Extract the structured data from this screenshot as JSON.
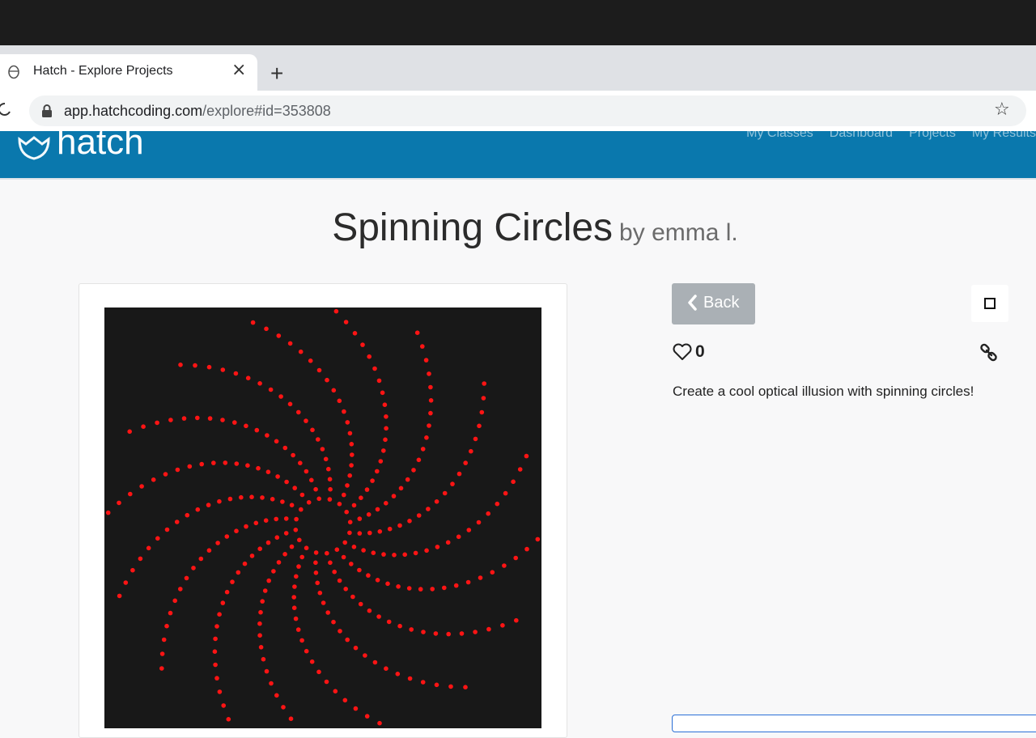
{
  "browser": {
    "tab_title": "Hatch - Explore Projects",
    "close_glyph": "×",
    "new_tab_glyph": "+",
    "url_host": "app.hatchcoding.com",
    "url_path": "/explore#id=353808",
    "bookmark_glyph": "☆"
  },
  "site": {
    "brand": "hatch",
    "brand_color": "#0a78ad",
    "nav": [
      "My Classes",
      "Dashboard",
      "Projects",
      "My Results"
    ]
  },
  "project": {
    "title": "Spinning Circles",
    "byline": "by emma l.",
    "back_label": "Back",
    "likes": "0",
    "description": "Create a cool optical illusion with spinning circles!"
  },
  "canvas": {
    "background": "#181818",
    "dot_color": "#ff1414",
    "arm_count": 16
  }
}
